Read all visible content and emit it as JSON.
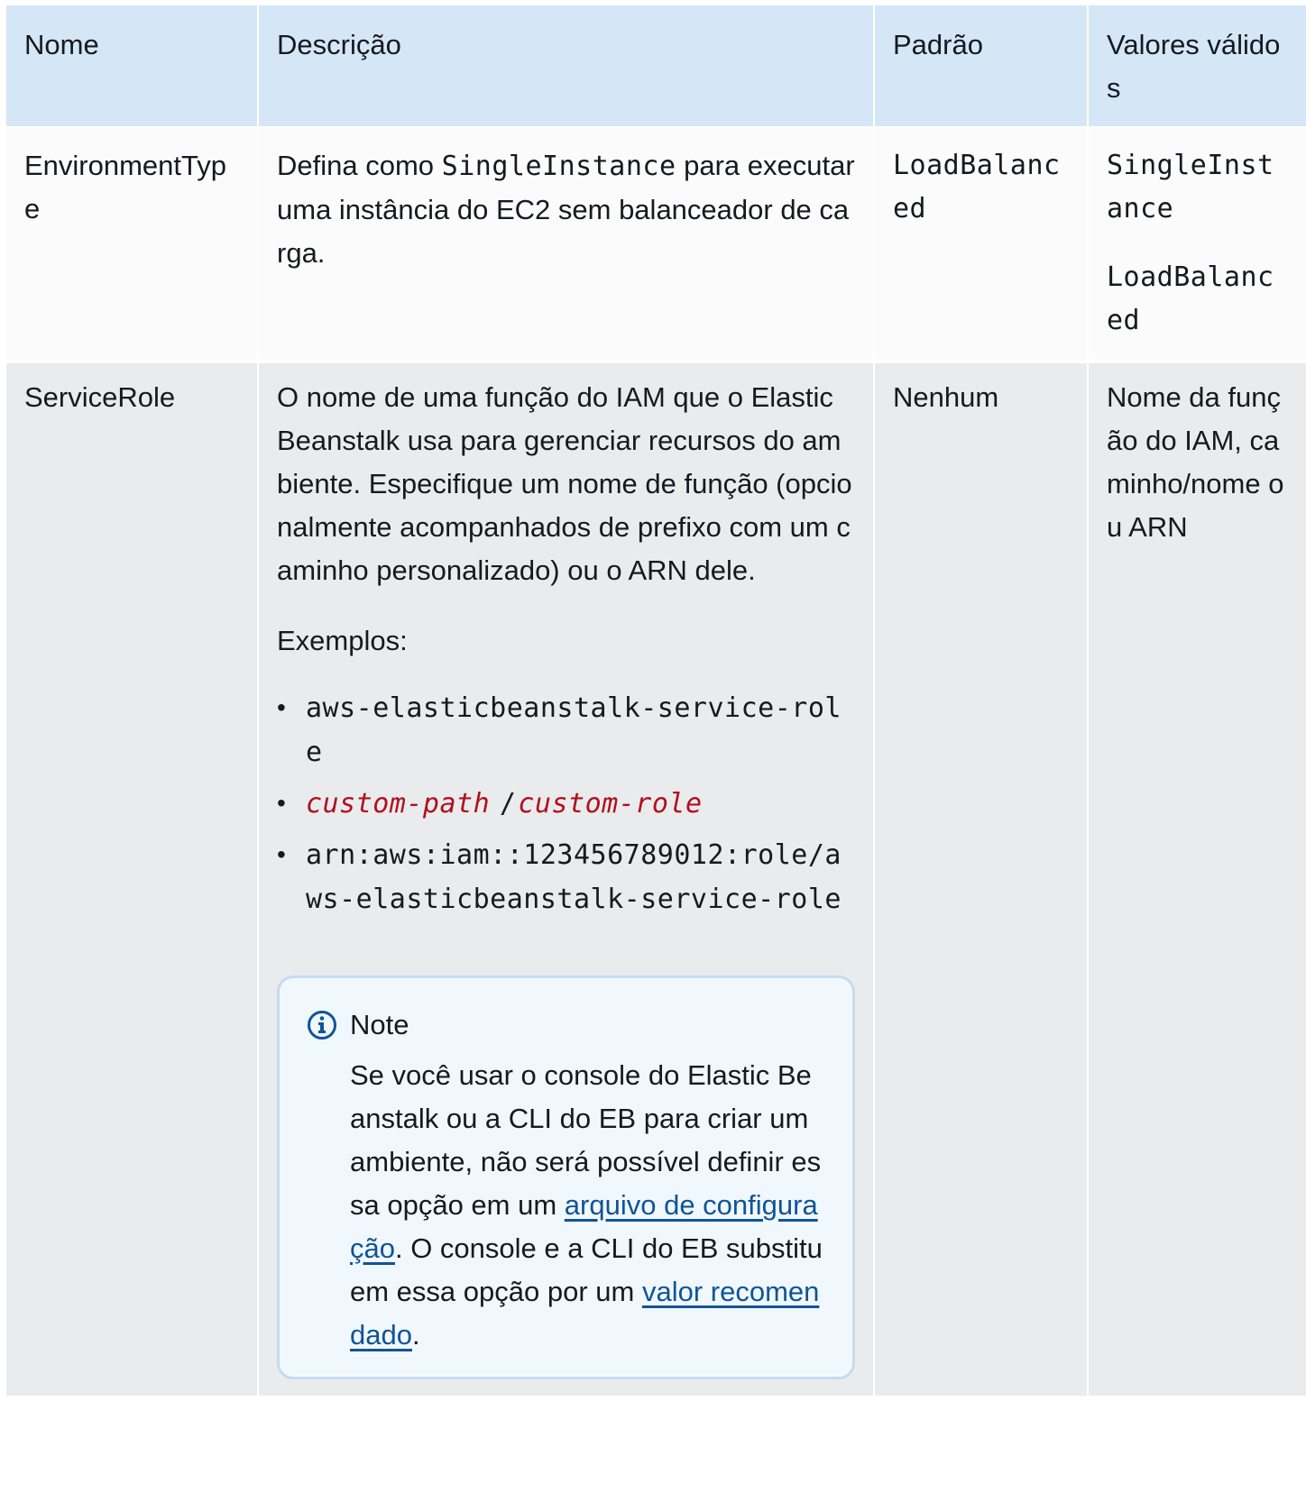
{
  "table": {
    "headers": [
      "Nome",
      "Descrição",
      "Padrão",
      "Valores válidos"
    ],
    "rows": [
      {
        "name": "EnvironmentType",
        "description": {
          "before": "Defina como ",
          "code": "SingleInstance",
          "after": " para executar uma instância do EC2 sem balanceador de carga."
        },
        "default": "LoadBalanced",
        "valid_values": [
          "SingleInstance",
          "LoadBalanced"
        ]
      },
      {
        "name": "ServiceRole",
        "description": {
          "paragraph": "O nome de uma função do IAM que o Elastic Beanstalk usa para gerenciar recursos do ambiente. Especifique um nome de função (opcionalmente acompanhados de prefixo com um caminho personalizado) ou o ARN dele.",
          "examples_label": "Exemplos:",
          "examples": {
            "first": "aws-elasticbeanstalk-service-role",
            "second_path": "custom-path",
            "second_sep": "/",
            "second_role": "custom-role",
            "third": "arn:aws:iam::123456789012:role/aws-elasticbeanstalk-service-role"
          },
          "note": {
            "title": "Note",
            "text_1": "Se você usar o console do Elastic Beanstalk ou a CLI do EB para criar um ambiente, não será possível definir essa opção em um ",
            "link_1": "arquivo de configuração",
            "text_2": ". O console e a CLI do EB substituem essa opção por um ",
            "link_2": "valor recomendado",
            "text_3": "."
          }
        },
        "default": "Nenhum",
        "valid_values": "Nome da função do IAM, caminho/nome ou ARN"
      }
    ]
  },
  "colors": {
    "header_bg": "#d5e7f6",
    "row1_bg": "#fbfbfb",
    "row2_bg": "#eaebed",
    "replaceable_text": "#b0101e",
    "link": "#0f5499",
    "note_bg": "#f1f8fd",
    "note_border": "#c6dbee"
  },
  "icons": {
    "note": "info-circle-icon"
  }
}
